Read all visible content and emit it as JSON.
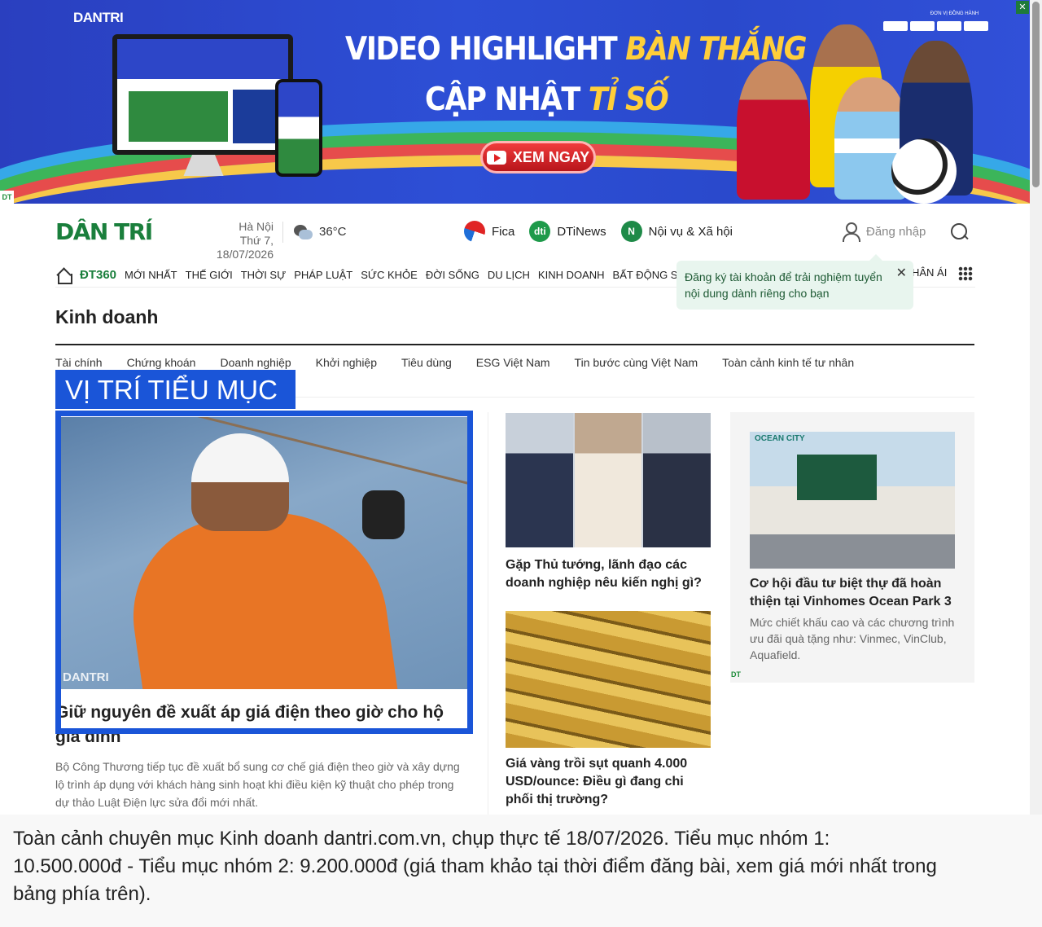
{
  "banner": {
    "logo": "DANTRI",
    "headline_line1_white": "VIDEO HIGHLIGHT",
    "headline_line1_gold": "BÀN THẮNG",
    "headline_line2_white": "CẬP NHẬT",
    "headline_line2_gold": "TỈ SỐ",
    "cta": "XEM NGAY",
    "sponsor_text": "ĐƠN VỊ ĐỒNG HÀNH",
    "close_icon": "close-icon",
    "ad_badge": "DT"
  },
  "header": {
    "logo": "DÂN TRÍ",
    "city": "Hà Nội",
    "date": "Thứ 7, 18/07/2026",
    "temperature": "36°C",
    "quicklinks": [
      {
        "label": "Fica",
        "icon": "fica-icon"
      },
      {
        "label": "DTiNews",
        "icon_text": "dti"
      },
      {
        "label": "Nội vụ & Xã hội",
        "icon_text": "N"
      }
    ],
    "login_label": "Đăng nhập"
  },
  "nav": {
    "dt360": "ĐT360",
    "items": [
      "MỚI NHẤT",
      "THẾ GIỚI",
      "THỜI SỰ",
      "PHÁP LUẬT",
      "SỨC KHỎE",
      "ĐỜI SỐNG",
      "DU LỊCH",
      "KINH DOANH",
      "BẤT ĐỘNG SẢN",
      "TH"
    ],
    "tail": "HÂN ÁI"
  },
  "tooltip": {
    "text": "Đăng ký tài khoản để trải nghiệm tuyển nội dung dành riêng cho bạn",
    "close": "✕"
  },
  "category": {
    "title": "Kinh doanh",
    "subnav": [
      "Tài chính",
      "Chứng khoán",
      "Doanh nghiệp",
      "Khởi nghiệp",
      "Tiêu dùng",
      "ESG Việt Nam",
      "Tin bước cùng Việt Nam",
      "Toàn cảnh kinh tế tư nhân"
    ],
    "label_box": "VỊ TRÍ TIỂU MỤC"
  },
  "main_article": {
    "image_watermark": "DANTRI",
    "title": "Giữ nguyên đề xuất áp giá điện theo giờ cho hộ gia đình",
    "description": "Bộ Công Thương tiếp tục đề xuất bổ sung cơ chế giá điện theo giờ và xây dựng lộ trình áp dụng với khách hàng sinh hoạt khi điều kiện kỹ thuật cho phép trong dự thảo Luật Điện lực sửa đổi mới nhất."
  },
  "side_articles": [
    {
      "title": "Gặp Thủ tướng, lãnh đạo các doanh nghiệp nêu kiến nghị gì?"
    },
    {
      "title": "Giá vàng trồi sụt quanh 4.000 USD/ounce: Điều gì đang chi phối thị trường?"
    }
  ],
  "sponsored": {
    "image_brand": "OCEAN CITY",
    "title": "Cơ hội đầu tư biệt thự đã hoàn thiện tại Vinhomes Ocean Park 3",
    "description": "Mức chiết khấu cao và các chương trình ưu đãi quà tặng như: Vinmec, VinClub, Aquafield.",
    "badge": "DT"
  },
  "caption": "Toàn cảnh chuyên mục Kinh doanh dantri.com.vn, chụp thực tế 18/07/2026. Tiểu mục nhóm 1: 10.500.000đ - Tiểu mục nhóm 2: 9.200.000đ (giá tham khảo tại thời điểm đăng bài, xem giá mới nhất trong bảng phía trên).",
  "colors": {
    "brand_green": "#1a7f3c",
    "highlight_blue": "#1a55d8",
    "banner_blue": "#2d4fd6"
  }
}
